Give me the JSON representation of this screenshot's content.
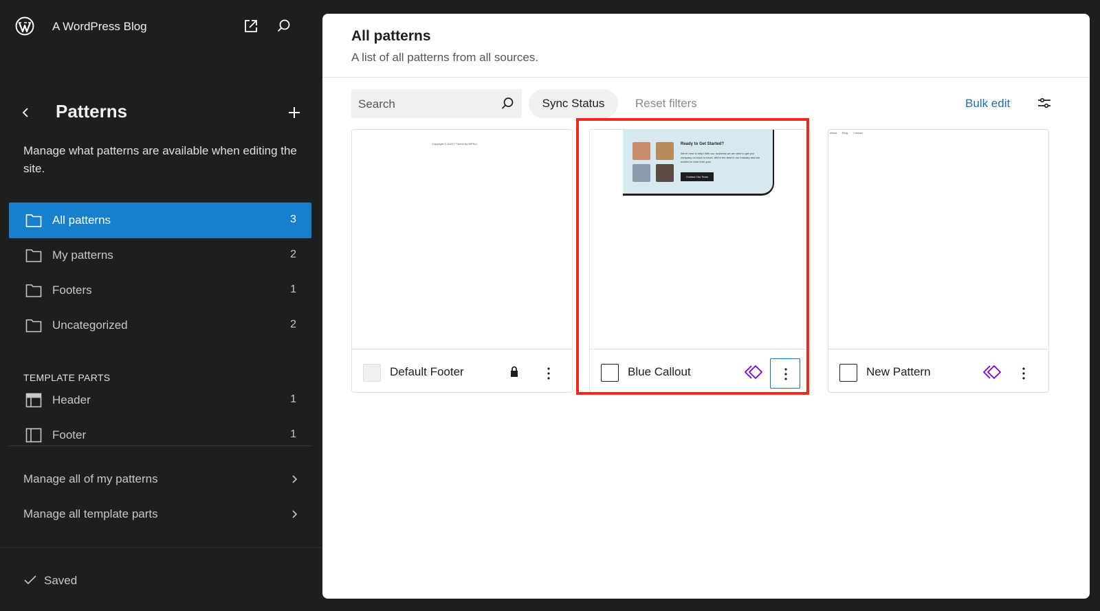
{
  "site": {
    "title": "A WordPress Blog"
  },
  "sidebar": {
    "heading": "Patterns",
    "description": "Manage what patterns are available when editing the site.",
    "items": [
      {
        "label": "All patterns",
        "count": "3",
        "active": true
      },
      {
        "label": "My patterns",
        "count": "2"
      },
      {
        "label": "Footers",
        "count": "1"
      },
      {
        "label": "Uncategorized",
        "count": "2"
      }
    ],
    "template_parts_label": "TEMPLATE PARTS",
    "template_parts": [
      {
        "label": "Header",
        "count": "1"
      },
      {
        "label": "Footer",
        "count": "1"
      }
    ],
    "links": [
      {
        "label": "Manage all of my patterns"
      },
      {
        "label": "Manage all template parts"
      }
    ],
    "status": "Saved"
  },
  "main": {
    "title": "All patterns",
    "subtitle": "A list of all patterns from all sources.",
    "search_placeholder": "Search",
    "sync_status_label": "Sync Status",
    "reset_label": "Reset filters",
    "bulk_edit_label": "Bulk edit",
    "cards": [
      {
        "name": "Default Footer",
        "badge": "lock-icon",
        "preview_text": "Copyright © 2024 | Theme by WPKoi"
      },
      {
        "name": "Blue Callout",
        "badge": "synced-pattern-icon",
        "preview": {
          "heading": "Ready to Get Started?",
          "body": "We're here to help! With our business we are able to get you company on track to excel. We're the best in our industry and are excited to hear from you!",
          "cta": "Contact Our Team"
        }
      },
      {
        "name": "New Pattern",
        "badge": "synced-pattern-icon",
        "preview_nav": [
          "About",
          "Blog",
          "Contact"
        ]
      }
    ]
  },
  "colors": {
    "accent": "#1780cc",
    "link": "#1a6fb8",
    "synced": "#7a00df",
    "highlight": "#ee2a1b",
    "sidebar_bg": "#1e1e1e"
  }
}
